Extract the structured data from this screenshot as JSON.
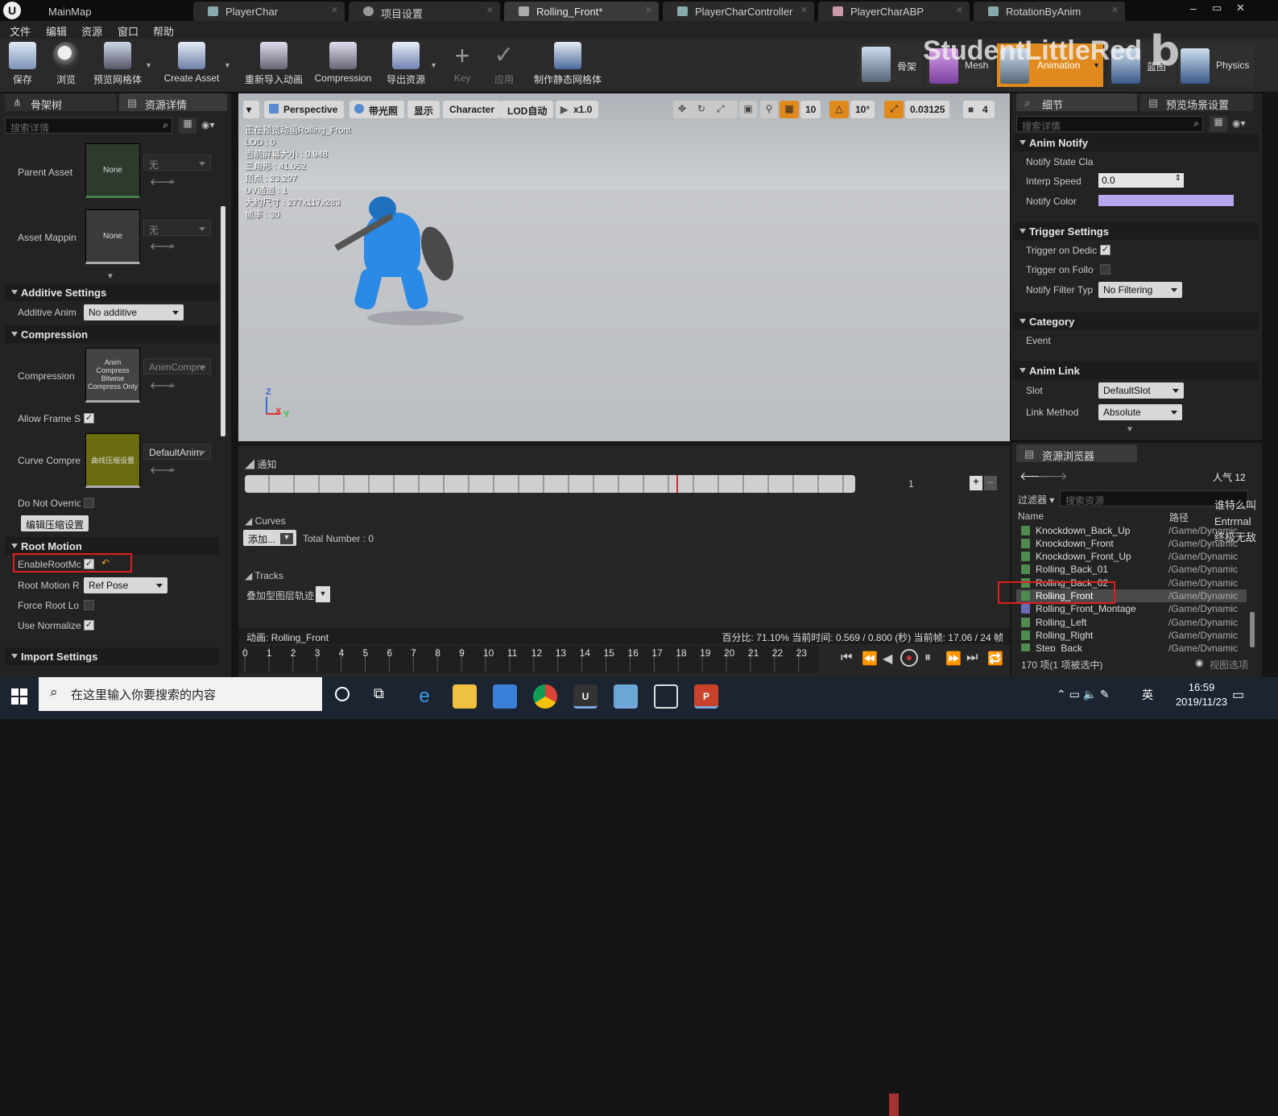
{
  "tabs": [
    {
      "label": "MainMap"
    },
    {
      "label": "PlayerChar"
    },
    {
      "label": "项目设置"
    },
    {
      "label": "Rolling_Front*"
    },
    {
      "label": "PlayerCharController"
    },
    {
      "label": "PlayerCharABP"
    },
    {
      "label": "RotationByAnim"
    }
  ],
  "menu": [
    "文件",
    "编辑",
    "资源",
    "窗口",
    "帮助"
  ],
  "toolbar": {
    "buttons": [
      "保存",
      "浏览",
      "预览网格体",
      "Create Asset",
      "重新导入动画",
      "Compression",
      "导出资源",
      "Key",
      "应用",
      "制作静态网格体"
    ],
    "modes": [
      "骨架",
      "Mesh",
      "Animation",
      "蓝图",
      "Physics"
    ]
  },
  "watermark": "StudentLittleRed",
  "left_panel": {
    "tabs": [
      "骨架树",
      "资源详情"
    ],
    "search_placeholder": "搜索详情",
    "parent_asset": {
      "label": "Parent Asset",
      "thumb": "None",
      "combo": "无"
    },
    "asset_mapping": {
      "label": "Asset Mappin",
      "thumb": "None",
      "combo": "无"
    },
    "additive_section": "Additive Settings",
    "additive_anim": {
      "label": "Additive Anim",
      "value": "No additive"
    },
    "compression_section": "Compression",
    "compression": {
      "label": "Compression",
      "thumb": "Anim Compress Bitwise Compress Only",
      "combo": "AnimCompre"
    },
    "allow_frame": {
      "label": "Allow Frame S",
      "checked": "✓"
    },
    "curve_compression": {
      "label": "Curve Compre",
      "thumb": "曲线压缩设置",
      "combo": "DefaultAnim"
    },
    "do_not_override": {
      "label": "Do Not Overric"
    },
    "edit_compression_btn": "编辑压缩设置",
    "root_motion_section": "Root Motion",
    "enable_root_motion": {
      "label": "EnableRootMc",
      "checked": "✓",
      "reset": "↶"
    },
    "root_motion_root": {
      "label": "Root Motion R",
      "value": "Ref Pose"
    },
    "force_root_lock": {
      "label": "Force Root Lo"
    },
    "use_normalized": {
      "label": "Use Normalize",
      "checked": "✓"
    },
    "import_section": "Import Settings"
  },
  "viewport": {
    "buttons": [
      "Perspective",
      "带光照",
      "显示",
      "Character",
      "LOD自动",
      "x1.0"
    ],
    "grid": "10",
    "angle": "10°",
    "scale": "0.03125",
    "camera_speed": "4",
    "info": [
      "正在预览动画Rolling_Front",
      "LOD : 0",
      "当前屏幕大小 : 0.948",
      "三角形 : 41,052",
      "顶点 : 23,297",
      "UV通道 : 1",
      "大约尺寸 : 277x117x283",
      "帧率 : 30"
    ],
    "axis_x": "X",
    "axis_y": "Y",
    "axis_z": "Z"
  },
  "timeline": {
    "notify_label": "通知",
    "track_number": "1",
    "curves_label": "Curves",
    "add_btn": "添加...",
    "total_number": "Total Number : 0",
    "tracks_label": "Tracks",
    "additive_tracks": "叠加型图层轨迹",
    "anim_name": "动画: Rolling_Front",
    "status": "百分比: 71.10% 当前时间: 0.569 / 0.800 (秒) 当前帧: 17.06 / 24 帧",
    "ticks": [
      "0",
      "1",
      "2",
      "3",
      "4",
      "5",
      "6",
      "7",
      "8",
      "9",
      "10",
      "11",
      "12",
      "13",
      "14",
      "15",
      "16",
      "17",
      "18",
      "19",
      "20",
      "21",
      "22",
      "23"
    ],
    "playhead_frame": 17.06,
    "total_frames": 24
  },
  "right_panel": {
    "tabs": [
      "细节",
      "预览场景设置"
    ],
    "search_placeholder": "搜索详情",
    "anim_notify_section": "Anim Notify",
    "notify_state_class": "Notify State Cla",
    "interp_speed": {
      "label": "Interp Speed",
      "value": "0.0"
    },
    "notify_color": {
      "label": "Notify Color",
      "color": "#b9a6f0"
    },
    "trigger_section": "Trigger Settings",
    "trigger_on_dedicated": {
      "label": "Trigger on Dedic",
      "checked": "✓"
    },
    "trigger_on_follower": {
      "label": "Trigger on Follo"
    },
    "notify_filter": {
      "label": "Notify Filter Typ",
      "value": "No Filtering"
    },
    "category_section": "Category",
    "event_label": "Event",
    "anim_link_section": "Anim Link",
    "slot": {
      "label": "Slot",
      "value": "DefaultSlot"
    },
    "link_method": {
      "label": "Link Method",
      "value": "Absolute"
    }
  },
  "asset_browser": {
    "tab": "资源浏览器",
    "popularity": "人气 12",
    "filter": "过滤器",
    "search_placeholder": "搜索资源",
    "col_name": "Name",
    "col_path": "路径",
    "items": [
      {
        "name": "Knockdown_Back_Up",
        "path": "/Game/Dynamic"
      },
      {
        "name": "Knockdown_Front",
        "path": "/Game/Dynamic"
      },
      {
        "name": "Knockdown_Front_Up",
        "path": "/Game/Dynamic"
      },
      {
        "name": "Rolling_Back_01",
        "path": "/Game/Dynamic"
      },
      {
        "name": "Rolling_Back_02",
        "path": "/Game/Dynamic"
      },
      {
        "name": "Rolling_Front",
        "path": "/Game/Dynamic"
      },
      {
        "name": "Rolling_Front_Montage",
        "path": "/Game/Dynamic"
      },
      {
        "name": "Rolling_Left",
        "path": "/Game/Dynamic"
      },
      {
        "name": "Rolling_Right",
        "path": "/Game/Dynamic"
      },
      {
        "name": "Step_Back",
        "path": "/Game/Dynamic"
      }
    ],
    "count": "170 项(1 项被选中)",
    "view_options": "视图选项",
    "overlay_chat": [
      "谁特么叫",
      "Entrrnal",
      "终极无敌"
    ]
  },
  "taskbar": {
    "search_placeholder": "在这里输入你要搜索的内容",
    "ime": "英",
    "time": "16:59",
    "date": "2019/11/23"
  }
}
